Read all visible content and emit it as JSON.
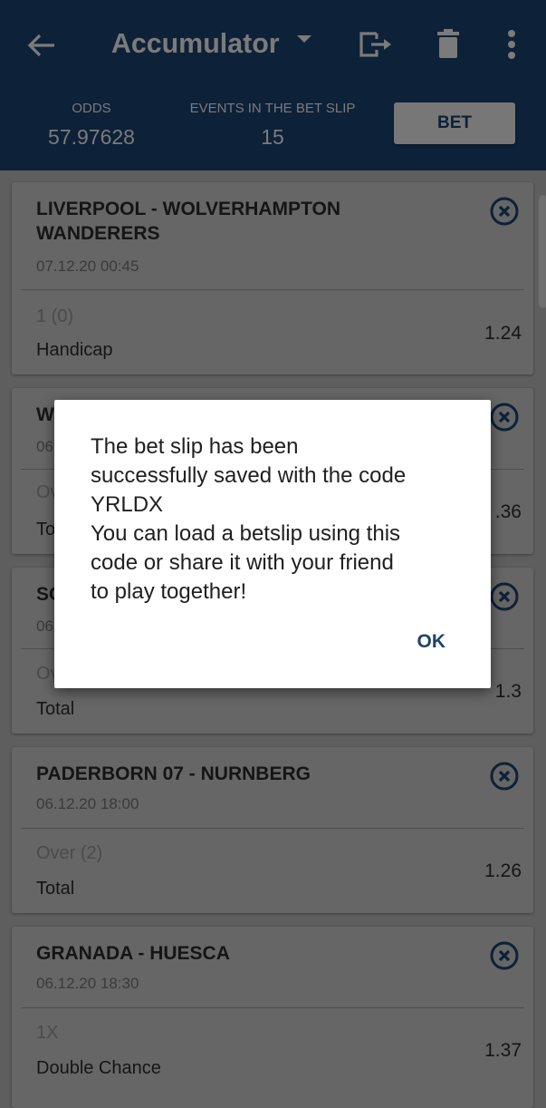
{
  "header": {
    "title": "Accumulator",
    "icons": {
      "back": "arrow-left-icon",
      "dropdown": "caret-down-icon",
      "save": "export-icon",
      "delete": "trash-icon",
      "more": "more-vert-icon"
    },
    "odds_label": "ODDS",
    "odds_value": "57.97628",
    "events_label": "EVENTS IN THE BET SLIP",
    "events_value": "15",
    "bet_button": "BET"
  },
  "bets": [
    {
      "match": "LIVERPOOL - WOLVERHAMPTON WANDERERS",
      "date": "07.12.20 00:45",
      "pick": "1 (0)",
      "market": "Handicap",
      "odd": "1.24"
    },
    {
      "match": "W",
      "date": "06",
      "pick": "Ov",
      "market": "To",
      "odd": ".36"
    },
    {
      "match": "SO",
      "date": "06",
      "pick": "Ov",
      "market": "Total",
      "odd": "1.3"
    },
    {
      "match": "PADERBORN 07 - NURNBERG",
      "date": "06.12.20 18:00",
      "pick": "Over (2)",
      "market": "Total",
      "odd": "1.26"
    },
    {
      "match": "GRANADA - HUESCA",
      "date": "06.12.20 18:30",
      "pick": "1X",
      "market": "Double Chance",
      "odd": "1.37"
    }
  ],
  "dialog": {
    "message": "The bet slip has been\nsuccessfully saved with the code\nYRLDX\nYou can load a betslip using this\ncode or share it with your friend\nto play together!",
    "ok_label": "OK"
  },
  "colors": {
    "header_bg": "#0d2138",
    "accent": "#1e4469",
    "overlay_dim": "#5e5e5e"
  }
}
